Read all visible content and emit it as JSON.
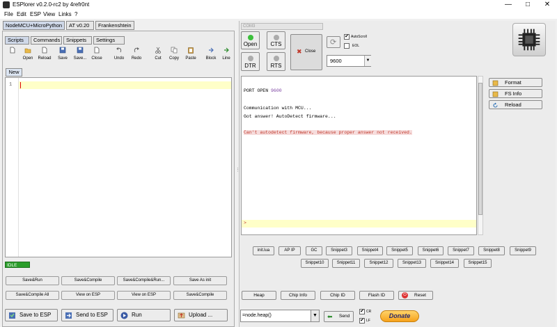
{
  "window": {
    "title": "ESPlorer v0.2.0-rc2 by 4refr0nt",
    "controls": [
      "—",
      "□",
      "✕"
    ]
  },
  "menu": [
    "File",
    "Edit",
    "ESP",
    "View",
    "Links",
    "?"
  ],
  "platform_tabs": [
    "NodeMCU+MicroPython",
    "AT v0.20",
    "Frankenshtein"
  ],
  "script_tabs": [
    "Scripts",
    "Commands",
    "Snippets",
    "Settings"
  ],
  "toolbar": [
    {
      "label": "Open",
      "icon": "open-folder-icon"
    },
    {
      "label": "Reload",
      "icon": "reload-icon"
    },
    {
      "label": "Save",
      "icon": "save-icon"
    },
    {
      "label": "Save...",
      "icon": "save-as-icon"
    },
    {
      "label": "Close",
      "icon": "close-file-icon"
    },
    {
      "label": "Undo",
      "icon": "undo-icon"
    },
    {
      "label": "Redo",
      "icon": "redo-icon"
    },
    {
      "label": "Cut",
      "icon": "cut-icon"
    },
    {
      "label": "Copy",
      "icon": "copy-icon"
    },
    {
      "label": "Paste",
      "icon": "paste-icon"
    },
    {
      "label": "Block",
      "icon": "block-icon"
    },
    {
      "label": "Line",
      "icon": "line-icon"
    }
  ],
  "editor": {
    "file_tab": "New",
    "line_number": "1"
  },
  "status": "IDLE",
  "left_buttons_row1": [
    "Save&Run",
    "Save&Compile",
    "Save&Compile&Run...",
    "Save As init"
  ],
  "left_buttons_row2": [
    "Save&Compile All",
    "View on ESP",
    "View on ESP",
    "Save&Compile"
  ],
  "bottom_buttons": [
    "Save to ESP",
    "Send to ESP",
    "Run",
    "Upload ..."
  ],
  "port": {
    "name": "COM3",
    "open_label": "Open",
    "cts_label": "CTS",
    "dtr_label": "DTR",
    "rts_label": "RTS",
    "close_label": "Close",
    "autoscroll_label": "AutoScroll",
    "autoscroll_checked": true,
    "eol_label": "EOL",
    "eol_checked": false,
    "baud": "9600"
  },
  "terminal": {
    "lines": [
      {
        "text": "PORT OPEN ",
        "value": "9600"
      },
      {
        "text": "Communication with MCU..."
      },
      {
        "text": "Got answer! AutoDetect firmware..."
      },
      {
        "text": "Can't autodetect firmware, because proper answer not received."
      },
      {
        "text": ">"
      }
    ]
  },
  "side_buttons": [
    "Format",
    "FS Info",
    "Reload"
  ],
  "snippets_row1": [
    "init.lua",
    "AP IP",
    "GC",
    "Snippet3",
    "Snippet4",
    "Snippet5",
    "Snippet6",
    "Snippet7",
    "Snippet8",
    "Snippet9"
  ],
  "snippets_row2": [
    "Snippet10",
    "Snippet11",
    "Snippet12",
    "Snippet13",
    "Snippet14",
    "Snippet15"
  ],
  "action_buttons": [
    "Heap",
    "Chip Info",
    "Chip ID",
    "Flash ID",
    "Reset"
  ],
  "command": {
    "value": "=node.heap()",
    "send_label": "Send",
    "cr_label": "CR",
    "lf_label": "LF",
    "cr_checked": true,
    "lf_checked": true,
    "donate_label": "Donate"
  },
  "colors": {
    "open_led": "#3cbf3c",
    "idle_led": "#ababab",
    "status_bg": "#2a9d2a",
    "terminal_error": "#c0392b",
    "terminal_highlight": "#ffffc8",
    "donate": "#f7a21b"
  }
}
